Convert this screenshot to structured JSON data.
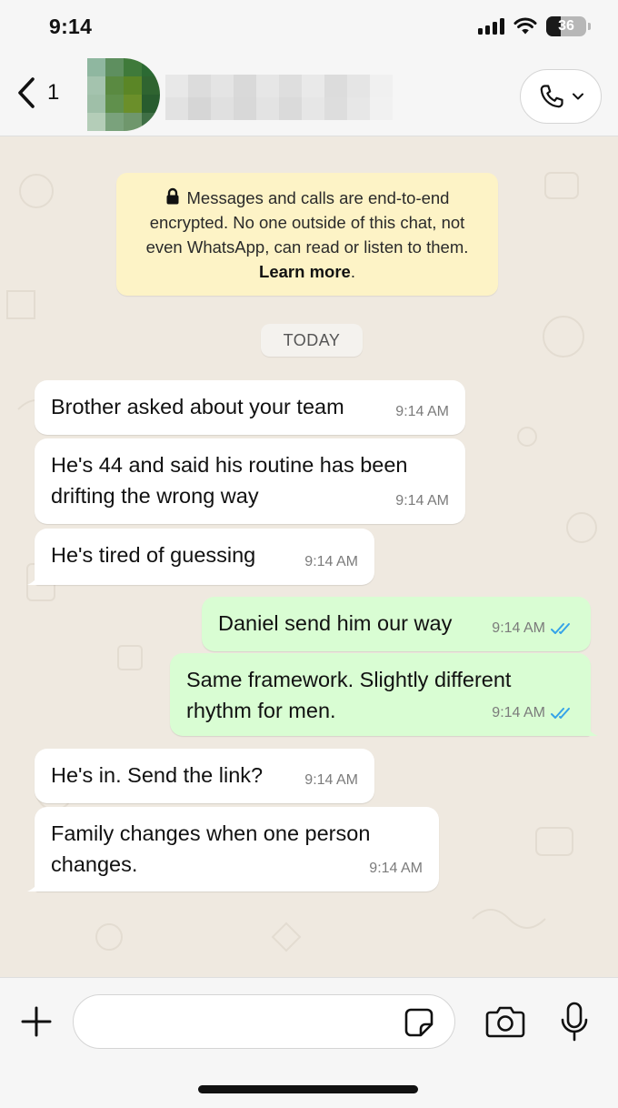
{
  "status_bar": {
    "time": "9:14",
    "battery": "36",
    "battery_level_percent": 36,
    "signal_icon": "cellular-signal-icon",
    "wifi_icon": "wifi-icon"
  },
  "header": {
    "back_count": "1",
    "back_icon": "chevron-left-icon",
    "call_icon": "phone-icon",
    "call_dropdown_icon": "chevron-down-icon"
  },
  "encryption_notice": {
    "lock_icon": "lock-icon",
    "text": "Messages and calls are end-to-end encrypted. No one outside of this chat, not even WhatsApp, can read or listen to them.",
    "link": "Learn more",
    "end": "."
  },
  "date_chip": "TODAY",
  "messages": [
    {
      "direction": "in",
      "text": "Brother asked about your team",
      "time": "9:14 AM"
    },
    {
      "direction": "in",
      "text": "He's 44 and said his routine has been drifting the wrong way",
      "time": "9:14 AM"
    },
    {
      "direction": "in",
      "text": "He's tired of guessing",
      "time": "9:14 AM"
    },
    {
      "direction": "out",
      "text": "Daniel send him our way",
      "time": "9:14 AM",
      "status": "read"
    },
    {
      "direction": "out",
      "text": "Same framework. Slightly different rhythm for men.",
      "time": "9:14 AM",
      "status": "read"
    },
    {
      "direction": "in",
      "text": "He's in. Send the link?",
      "time": "9:14 AM"
    },
    {
      "direction": "in",
      "text": "Family changes when one person changes.",
      "time": "9:14 AM"
    }
  ],
  "composer": {
    "placeholder": "",
    "plus_icon": "plus-icon",
    "sticker_icon": "sticker-icon",
    "camera_icon": "camera-icon",
    "mic_icon": "microphone-icon"
  },
  "colors": {
    "incoming_bubble": "#ffffff",
    "outgoing_bubble": "#d9fdd3",
    "read_ticks": "#35a3e8",
    "encryption_banner": "#fdf3c6",
    "chat_background": "#efe9e0"
  }
}
